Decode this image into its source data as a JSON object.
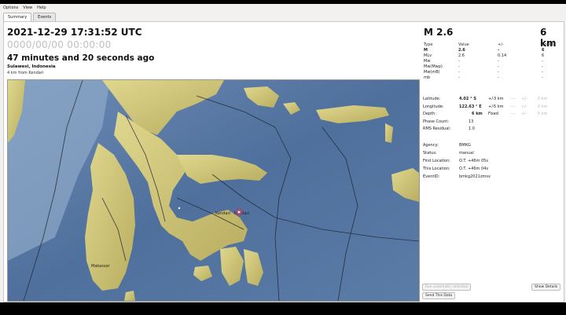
{
  "menu": {
    "items": [
      "Options",
      "View",
      "Help"
    ]
  },
  "tabs": [
    {
      "label": "Summary",
      "active": true
    },
    {
      "label": "Events",
      "active": false
    }
  ],
  "summary": {
    "origin_time": "2021-12-29 17:31:52 UTC",
    "zero_time": "0000/00/00  00:00:00",
    "elapsed": "47 minutes and 20 seconds ago",
    "region": "Sulawesi, Indonesia",
    "distance": "4 km from Kendari"
  },
  "header": {
    "magnitude": "M 2.6",
    "depth": "6 km"
  },
  "magnitude_table": {
    "headers": [
      "Type",
      "Value",
      "+/-",
      "Count"
    ],
    "rows": [
      {
        "type": "M",
        "value": "2.6",
        "pm": "-",
        "count": "6",
        "bold": true
      },
      {
        "type": "MLv",
        "value": "2.6",
        "pm": "0.14",
        "count": "6",
        "bold": false
      },
      {
        "type": "Mw",
        "value": "-",
        "pm": "-",
        "count": "-",
        "bold": false
      },
      {
        "type": "Mw(Mwp)",
        "value": "-",
        "pm": "-",
        "count": "-",
        "bold": false
      },
      {
        "type": "Mw(mB)",
        "value": "-",
        "pm": "-",
        "count": "-",
        "bold": false
      },
      {
        "type": "mb",
        "value": "-",
        "pm": "-",
        "count": "-",
        "bold": false
      }
    ]
  },
  "location": {
    "latitude_label": "Latitude:",
    "latitude_value": "4.02 ° S",
    "latitude_unc": "3 km",
    "longitude_label": "Longitude:",
    "longitude_value": "122.63 ° E",
    "longitude_unc": "5 km",
    "depth_label": "Depth:",
    "depth_value": "6 km",
    "depth_status": "Fixed",
    "phase_label": "Phase Count:",
    "phase_value": "13",
    "rms_label": "RMS Residual:",
    "rms_value": "1.0",
    "plus_minus": "+/-",
    "grey_dashes": "----",
    "grey_km": "0 km"
  },
  "agency": {
    "agency_label": "Agency:",
    "agency_value": "BMKG",
    "status_label": "Status:",
    "status_value": "manual",
    "first_label": "First Location:",
    "first_value": "O.T. +46m 05s",
    "this_label": "This Location:",
    "this_value": "O.T. +46m 04s",
    "event_label": "EventID:",
    "event_value": "bmkg2021zmsv"
  },
  "buttons": {
    "auto_select": "Run automatic selection",
    "show_details": "Show Details",
    "send": "Send This Data"
  },
  "map": {
    "city_main": "Kendari",
    "city_epicenter": "Kendari",
    "city_south": "Makassar",
    "sea_color": "#4f6f9c",
    "land_color": "#d4c97c",
    "epicenter_color": "#d9567c"
  }
}
